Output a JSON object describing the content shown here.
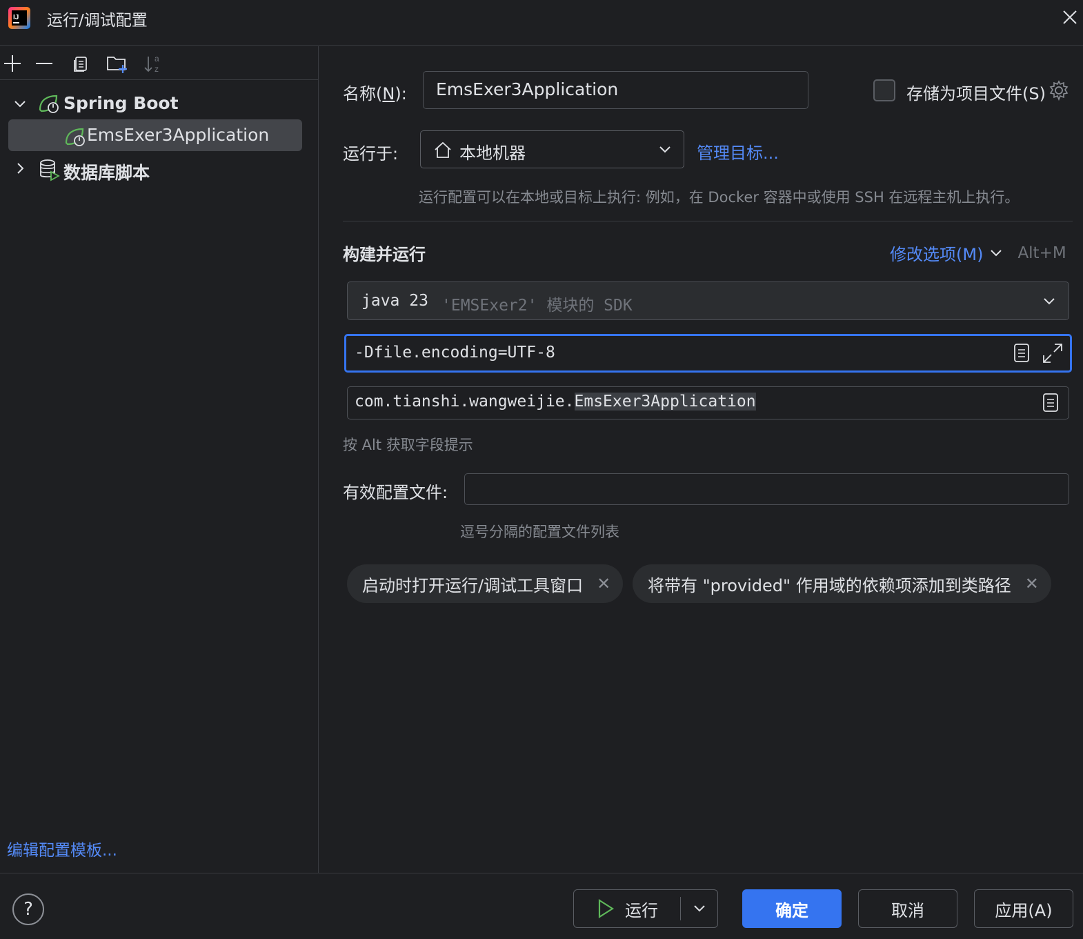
{
  "window": {
    "title": "运行/调试配置"
  },
  "toolbar": {
    "icons": [
      "add-icon",
      "remove-icon",
      "copy-icon",
      "new-folder-icon",
      "sort-alpha-icon"
    ]
  },
  "tree": {
    "groups": [
      {
        "label": "Spring Boot",
        "expanded": true,
        "children": [
          {
            "label": "EmsExer3Application",
            "selected": true
          }
        ]
      },
      {
        "label": "数据库脚本",
        "expanded": false,
        "children": []
      }
    ]
  },
  "left_footer": {
    "edit_templates": "编辑配置模板..."
  },
  "form": {
    "name_label_prefix": "名称(",
    "name_label_mnemonic": "N",
    "name_label_suffix": "):",
    "name_value": "EmsExer3Application",
    "store_as_project_file": "存储为项目文件(S)",
    "store_checked": false,
    "run_on_label": "运行于:",
    "run_on_value": "本地机器",
    "manage_targets": "管理目标...",
    "run_on_hint": "运行配置可以在本地或目标上执行: 例如，在 Docker 容器中或使用 SSH 在远程主机上执行。",
    "section_title": "构建并运行",
    "modify_options": "修改选项(M)",
    "modify_shortcut": "Alt+M",
    "sdk_main": "java 23",
    "sdk_detail": "'EMSExer2' 模块的 SDK",
    "vm_options": "-Dfile.encoding=UTF-8",
    "main_class_pkg": "com.tianshi.wangweijie.",
    "main_class_name": "EmsExer3Application",
    "alt_hint": "按 Alt 获取字段提示",
    "active_profiles_label": "有效配置文件:",
    "active_profiles_value": "",
    "profiles_hint": "逗号分隔的配置文件列表",
    "chips": [
      "启动时打开运行/调试工具窗口",
      "将带有 \"provided\" 作用域的依赖项添加到类路径"
    ]
  },
  "footer": {
    "help": "?",
    "run": "运行",
    "ok": "确定",
    "cancel": "取消",
    "apply": "应用(A)"
  },
  "colors": {
    "background": "#1e1f22",
    "accent": "#3574f0",
    "link": "#548af7",
    "focus_border": "#3574f0",
    "spring_green": "#5fb85a"
  }
}
